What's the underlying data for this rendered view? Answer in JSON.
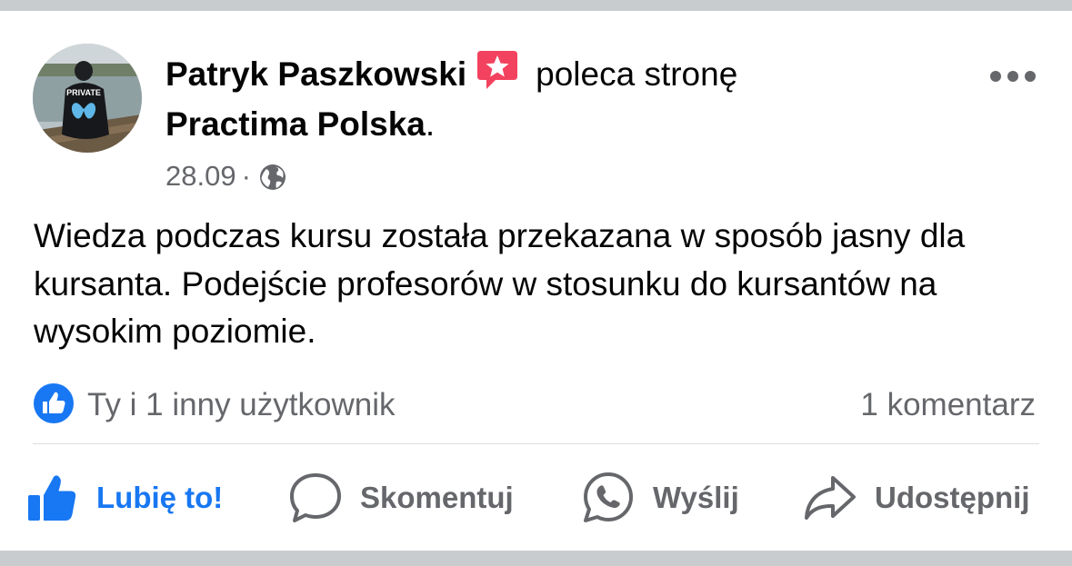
{
  "post": {
    "author": "Patryk Paszkowski",
    "verb": "poleca stronę",
    "page": "Practima Polska",
    "page_suffix": ".",
    "date": "28.09",
    "separator": "·",
    "body": "Wiedza podczas kursu została przekazana w sposób jasny dla kursanta. Podejście profesorów w stosunku do kursantów na wysokim poziomie.",
    "avatar_jacket_text": "PRIVATE"
  },
  "reactions": {
    "text": "Ty i 1 inny użytkownik",
    "comments": "1 komentarz"
  },
  "actions": {
    "like": "Lubię to!",
    "comment": "Skomentuj",
    "send": "Wyślij",
    "share": "Udostępnij"
  },
  "icons": {
    "recommend": "recommend-badge-icon",
    "audience": "globe-icon",
    "more": "more-options-icon",
    "like_reaction": "like-reaction-icon",
    "like": "thumbs-up-icon",
    "comment": "comment-bubble-icon",
    "send": "whatsapp-icon",
    "share": "share-arrow-icon"
  },
  "colors": {
    "accent": "#1877f2",
    "recommend_badge": "#f3425f",
    "secondary_text": "#65676b",
    "primary_text": "#050505",
    "page_background": "#c9cccf"
  }
}
